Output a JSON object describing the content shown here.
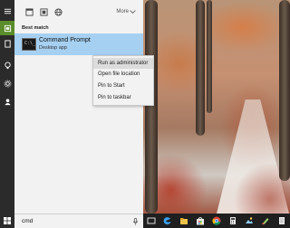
{
  "toolbar": {
    "more_label": "More",
    "icons": [
      "documents-icon",
      "apps-icon",
      "web-icon"
    ]
  },
  "best_match": {
    "label": "Best match",
    "result": {
      "title": "Command Prompt",
      "subtitle": "Desktop app",
      "icon": "command-prompt-icon",
      "icon_glyph": "C:\\_"
    }
  },
  "context_menu": {
    "items": [
      {
        "label": "Run as administrator",
        "highlighted": true
      },
      {
        "label": "Open file location",
        "highlighted": false
      },
      {
        "label": "Pin to Start",
        "highlighted": false
      },
      {
        "label": "Pin to taskbar",
        "highlighted": false
      }
    ]
  },
  "search": {
    "value": "cmd"
  },
  "rail": {
    "icons": [
      "hamburger-menu-icon",
      "home-icon",
      "notebook-icon",
      "feedback-icon",
      "settings-icon"
    ]
  },
  "taskbar": {
    "apps": [
      "task-view-icon",
      "edge-icon",
      "file-explorer-icon",
      "store-icon",
      "chrome-icon",
      "calculator-icon",
      "photos-icon",
      "paint-icon",
      "notepad-icon"
    ]
  },
  "colors": {
    "accent": "#a6d0f1",
    "rail_active": "#7cb342",
    "taskbar": "#1f1f1f"
  }
}
